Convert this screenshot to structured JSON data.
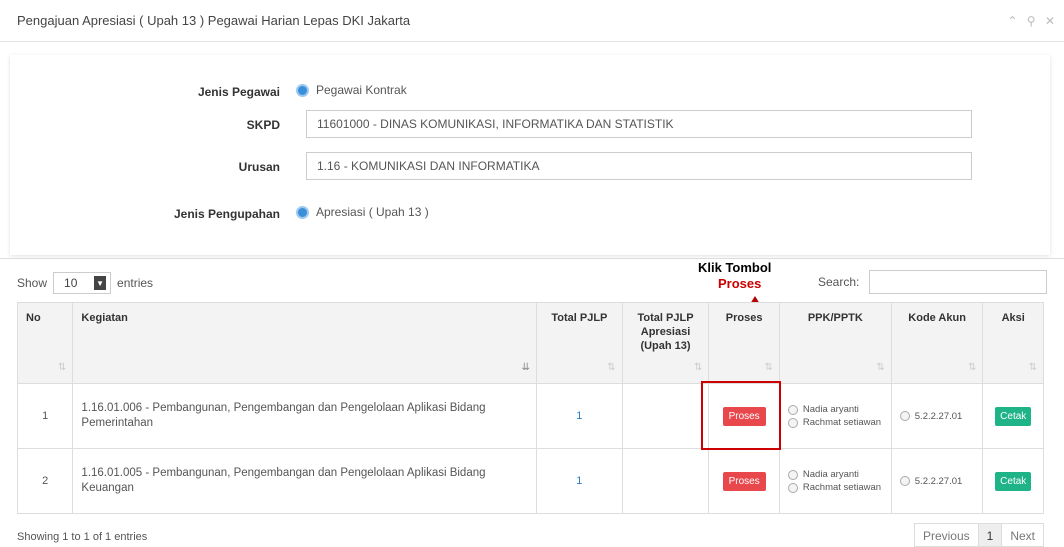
{
  "header": {
    "title": "Pengajuan Apresiasi ( Upah 13 ) Pegawai Harian Lepas DKI Jakarta",
    "tools": "^ ⚲ ✕"
  },
  "form": {
    "jenis_pegawai": {
      "label": "Jenis Pegawai",
      "value": "Pegawai Kontrak"
    },
    "skpd": {
      "label": "SKPD",
      "value": "11601000 - DINAS KOMUNIKASI, INFORMATIKA DAN STATISTIK"
    },
    "urusan": {
      "label": "Urusan",
      "value": "1.16 - KOMUNIKASI DAN INFORMATIKA"
    },
    "jenis_pengupahan": {
      "label": "Jenis Pengupahan",
      "value": "Apresiasi ( Upah 13 )"
    }
  },
  "annotation": {
    "title": "Klik Tombol",
    "subtitle": "Proses",
    "color": "#cc0000"
  },
  "table_controls": {
    "show_label": "Show",
    "entries_value": "10",
    "entries_label": "entries",
    "search_label": "Search:",
    "search_value": ""
  },
  "columns": [
    "No",
    "Kegiatan",
    "Total PJLP",
    "Total PJLP Apresiasi (Upah 13)",
    "Proses",
    "PPK/PPTK",
    "Kode Akun",
    "Aksi"
  ],
  "rows": [
    {
      "no": "1",
      "kegiatan": "1.16.01.006 - Pembangunan, Pengembangan dan Pengelolaan Aplikasi Bidang Pemerintahan",
      "total_pjlp": "1",
      "total_apresiasi": "",
      "proses_label": "Proses",
      "ppk_options": [
        "Nadia aryanti",
        "Rachmat setiawan"
      ],
      "kode_akun": "5.2.2.27.01",
      "aksi_label": "Cetak"
    },
    {
      "no": "2",
      "kegiatan": "1.16.01.005 - Pembangunan, Pengembangan dan Pengelolaan Aplikasi Bidang Keuangan",
      "total_pjlp": "1",
      "total_apresiasi": "",
      "proses_label": "Proses",
      "ppk_options": [
        "Nadia aryanti",
        "Rachmat setiawan"
      ],
      "kode_akun": "5.2.2.27.01",
      "aksi_label": "Cetak"
    }
  ],
  "footer": {
    "info": "Showing 1 to 1 of 1 entries",
    "previous": "Previous",
    "page": "1",
    "next": "Next"
  },
  "colors": {
    "radio_accent": "#3a8fd9",
    "proses_button": "#e8474c",
    "cetak_button": "#1fb388",
    "link": "#2a7ccf"
  }
}
